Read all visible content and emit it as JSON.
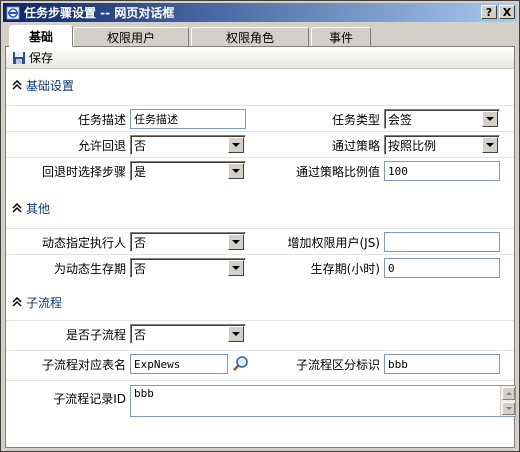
{
  "window": {
    "title": "任务步骤设置  -- 网页对话框",
    "help_label": "?",
    "close_label": "X"
  },
  "tabs": [
    {
      "label": "基础",
      "active": true
    },
    {
      "label": "权限用户"
    },
    {
      "label": "权限角色"
    },
    {
      "label": "事件"
    }
  ],
  "toolbar": {
    "save_label": "保存"
  },
  "sections": {
    "basic": "基础设置",
    "other": "其他",
    "subflow": "子流程"
  },
  "fields": {
    "task_desc": {
      "label": "任务描述",
      "value": "任务描述"
    },
    "task_type": {
      "label": "任务类型",
      "value": "会签"
    },
    "allow_back": {
      "label": "允许回退",
      "value": "否"
    },
    "pass_policy": {
      "label": "通过策略",
      "value": "按照比例"
    },
    "back_select_step": {
      "label": "回退时选择步骤",
      "value": "是"
    },
    "pass_ratio": {
      "label": "通过策略比例值",
      "value": "100"
    },
    "dyn_executor": {
      "label": "动态指定执行人",
      "value": "否"
    },
    "add_perm_users": {
      "label": "增加权限用户(JS)",
      "value": ""
    },
    "dyn_lifetime": {
      "label": "为动态生存期",
      "value": "否"
    },
    "lifetime_hours": {
      "label": "生存期(小时)",
      "value": "0"
    },
    "is_subflow": {
      "label": "是否子流程",
      "value": "否"
    },
    "subflow_table": {
      "label": "子流程对应表名",
      "value": "ExpNews"
    },
    "subflow_flag": {
      "label": "子流程区分标识",
      "value": "bbb"
    },
    "subflow_record_id": {
      "label": "子流程记录ID",
      "value": "bbb"
    }
  },
  "colors": {
    "title_start": "#0a246a",
    "title_end": "#a6caf0",
    "section_text": "#0a3b78",
    "chrome": "#d4d0c8"
  },
  "icons": {
    "window": "ie-page-icon",
    "save": "floppy-disk-icon",
    "section": "double-chevron-up-icon",
    "lookup": "magnifier-icon"
  }
}
